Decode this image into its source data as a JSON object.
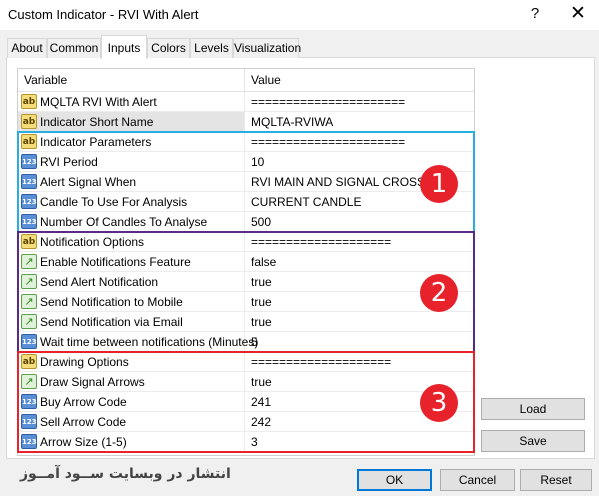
{
  "window": {
    "title": "Custom Indicator - RVI With Alert",
    "help_glyph": "?",
    "close_glyph": "✕"
  },
  "tabs": [
    "About",
    "Common",
    "Inputs",
    "Colors",
    "Levels",
    "Visualization"
  ],
  "active_tab": "Inputs",
  "grid": {
    "col_variable": "Variable",
    "col_value": "Value",
    "rows": [
      {
        "icon": "ab",
        "name": "MQLTA RVI With Alert",
        "value": "======================"
      },
      {
        "icon": "ab",
        "name": "Indicator Short Name",
        "value": "MQLTA-RVIWA"
      },
      {
        "icon": "ab",
        "name": "Indicator Parameters",
        "value": "======================"
      },
      {
        "icon": "123",
        "name": "RVI Period",
        "value": "10"
      },
      {
        "icon": "123",
        "name": "Alert Signal When",
        "value": "RVI MAIN AND SIGNAL CROSS"
      },
      {
        "icon": "123",
        "name": "Candle To Use For Analysis",
        "value": "CURRENT CANDLE"
      },
      {
        "icon": "123",
        "name": "Number Of Candles To Analyse",
        "value": "500"
      },
      {
        "icon": "ab",
        "name": "Notification Options",
        "value": "===================="
      },
      {
        "icon": "bool",
        "name": "Enable Notifications Feature",
        "value": "false"
      },
      {
        "icon": "bool",
        "name": "Send Alert Notification",
        "value": "true"
      },
      {
        "icon": "bool",
        "name": "Send Notification to Mobile",
        "value": "true"
      },
      {
        "icon": "bool",
        "name": "Send Notification via Email",
        "value": "true"
      },
      {
        "icon": "123",
        "name": "Wait time between notifications (Minutes)",
        "value": "5"
      },
      {
        "icon": "ab",
        "name": "Drawing Options",
        "value": "===================="
      },
      {
        "icon": "bool",
        "name": "Draw Signal Arrows",
        "value": "true"
      },
      {
        "icon": "123",
        "name": "Buy Arrow Code",
        "value": "241"
      },
      {
        "icon": "123",
        "name": "Sell Arrow Code",
        "value": "242"
      },
      {
        "icon": "123",
        "name": "Arrow Size (1-5)",
        "value": "3"
      }
    ],
    "icon_labels": {
      "ab": "ab",
      "num": "123",
      "bool": "↗"
    }
  },
  "annotations": {
    "group1_color": "#2aaee0",
    "group2_color": "#5b2a86",
    "group3_color": "#e8222a",
    "badges": [
      "1",
      "2",
      "3"
    ]
  },
  "buttons": {
    "load": "Load",
    "save": "Save",
    "ok": "OK",
    "cancel": "Cancel",
    "reset": "Reset"
  },
  "watermark": "انتشار در وبسایت ســود آمــوز"
}
